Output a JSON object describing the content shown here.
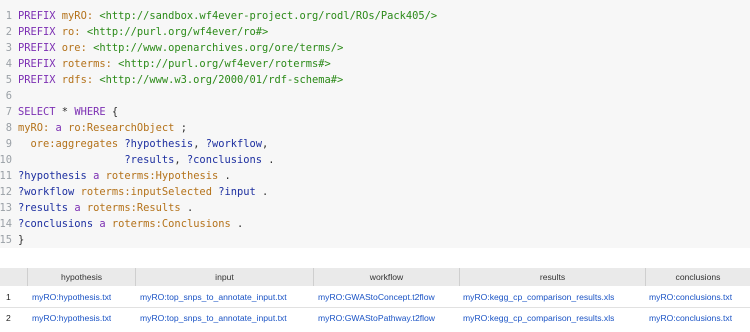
{
  "editor": {
    "lines": [
      {
        "n": "1",
        "t": [
          {
            "c": "kw",
            "v": "PREFIX "
          },
          {
            "c": "pn",
            "v": "myRO:"
          },
          {
            "c": "punc",
            "v": " "
          },
          {
            "c": "iri",
            "v": "<http://sandbox.wf4ever-project.org/rodl/ROs/Pack405/>"
          }
        ]
      },
      {
        "n": "2",
        "t": [
          {
            "c": "kw",
            "v": "PREFIX "
          },
          {
            "c": "pn",
            "v": "ro:"
          },
          {
            "c": "punc",
            "v": " "
          },
          {
            "c": "iri",
            "v": "<http://purl.org/wf4ever/ro#>"
          }
        ]
      },
      {
        "n": "3",
        "t": [
          {
            "c": "kw",
            "v": "PREFIX "
          },
          {
            "c": "pn",
            "v": "ore:"
          },
          {
            "c": "punc",
            "v": " "
          },
          {
            "c": "iri",
            "v": "<http://www.openarchives.org/ore/terms/>"
          }
        ]
      },
      {
        "n": "4",
        "t": [
          {
            "c": "kw",
            "v": "PREFIX "
          },
          {
            "c": "pn",
            "v": "roterms:"
          },
          {
            "c": "punc",
            "v": " "
          },
          {
            "c": "iri",
            "v": "<http://purl.org/wf4ever/roterms#>"
          }
        ]
      },
      {
        "n": "5",
        "t": [
          {
            "c": "kw",
            "v": "PREFIX "
          },
          {
            "c": "pn",
            "v": "rdfs:"
          },
          {
            "c": "punc",
            "v": " "
          },
          {
            "c": "iri",
            "v": "<http://www.w3.org/2000/01/rdf-schema#>"
          }
        ]
      },
      {
        "n": "6",
        "t": []
      },
      {
        "n": "7",
        "t": [
          {
            "c": "kw",
            "v": "SELECT "
          },
          {
            "c": "punc",
            "v": "* "
          },
          {
            "c": "kw",
            "v": "WHERE "
          },
          {
            "c": "punc",
            "v": "{"
          }
        ]
      },
      {
        "n": "8",
        "t": [
          {
            "c": "pn",
            "v": "myRO:"
          },
          {
            "c": "punc",
            "v": " "
          },
          {
            "c": "kw",
            "v": "a"
          },
          {
            "c": "punc",
            "v": " "
          },
          {
            "c": "pn",
            "v": "ro:ResearchObject"
          },
          {
            "c": "punc",
            "v": " ;"
          }
        ]
      },
      {
        "n": "9",
        "t": [
          {
            "c": "punc",
            "v": "  "
          },
          {
            "c": "pn",
            "v": "ore:aggregates"
          },
          {
            "c": "punc",
            "v": " "
          },
          {
            "c": "var",
            "v": "?hypothesis"
          },
          {
            "c": "punc",
            "v": ", "
          },
          {
            "c": "var",
            "v": "?workflow"
          },
          {
            "c": "punc",
            "v": ","
          }
        ]
      },
      {
        "n": "10",
        "t": [
          {
            "c": "punc",
            "v": "                 "
          },
          {
            "c": "var",
            "v": "?results"
          },
          {
            "c": "punc",
            "v": ", "
          },
          {
            "c": "var",
            "v": "?conclusions"
          },
          {
            "c": "punc",
            "v": " ."
          }
        ]
      },
      {
        "n": "11",
        "t": [
          {
            "c": "var",
            "v": "?hypothesis"
          },
          {
            "c": "punc",
            "v": " "
          },
          {
            "c": "kw",
            "v": "a"
          },
          {
            "c": "punc",
            "v": " "
          },
          {
            "c": "pn",
            "v": "roterms:Hypothesis"
          },
          {
            "c": "punc",
            "v": " ."
          }
        ]
      },
      {
        "n": "12",
        "t": [
          {
            "c": "var",
            "v": "?workflow"
          },
          {
            "c": "punc",
            "v": " "
          },
          {
            "c": "pn",
            "v": "roterms:inputSelected"
          },
          {
            "c": "punc",
            "v": " "
          },
          {
            "c": "var",
            "v": "?input"
          },
          {
            "c": "punc",
            "v": " ."
          }
        ]
      },
      {
        "n": "13",
        "t": [
          {
            "c": "var",
            "v": "?results"
          },
          {
            "c": "punc",
            "v": " "
          },
          {
            "c": "kw",
            "v": "a"
          },
          {
            "c": "punc",
            "v": " "
          },
          {
            "c": "pn",
            "v": "roterms:Results"
          },
          {
            "c": "punc",
            "v": " ."
          }
        ]
      },
      {
        "n": "14",
        "t": [
          {
            "c": "var",
            "v": "?conclusions"
          },
          {
            "c": "punc",
            "v": " "
          },
          {
            "c": "kw",
            "v": "a"
          },
          {
            "c": "punc",
            "v": " "
          },
          {
            "c": "pn",
            "v": "roterms:Conclusions"
          },
          {
            "c": "punc",
            "v": " ."
          }
        ]
      },
      {
        "n": "15",
        "t": [
          {
            "c": "punc",
            "v": "}"
          }
        ]
      }
    ]
  },
  "results": {
    "columns": [
      "hypothesis",
      "input",
      "workflow",
      "results",
      "conclusions"
    ],
    "rows": [
      {
        "num": "1",
        "cells": [
          "myRO:hypothesis.txt",
          "myRO:top_snps_to_annotate_input.txt",
          "myRO:GWAStoConcept.t2flow",
          "myRO:kegg_cp_comparison_results.xls",
          "myRO:conclusions.txt"
        ]
      },
      {
        "num": "2",
        "cells": [
          "myRO:hypothesis.txt",
          "myRO:top_snps_to_annotate_input.txt",
          "myRO:GWAStoPathway.t2flow",
          "myRO:kegg_cp_comparison_results.xls",
          "myRO:conclusions.txt"
        ]
      }
    ]
  }
}
